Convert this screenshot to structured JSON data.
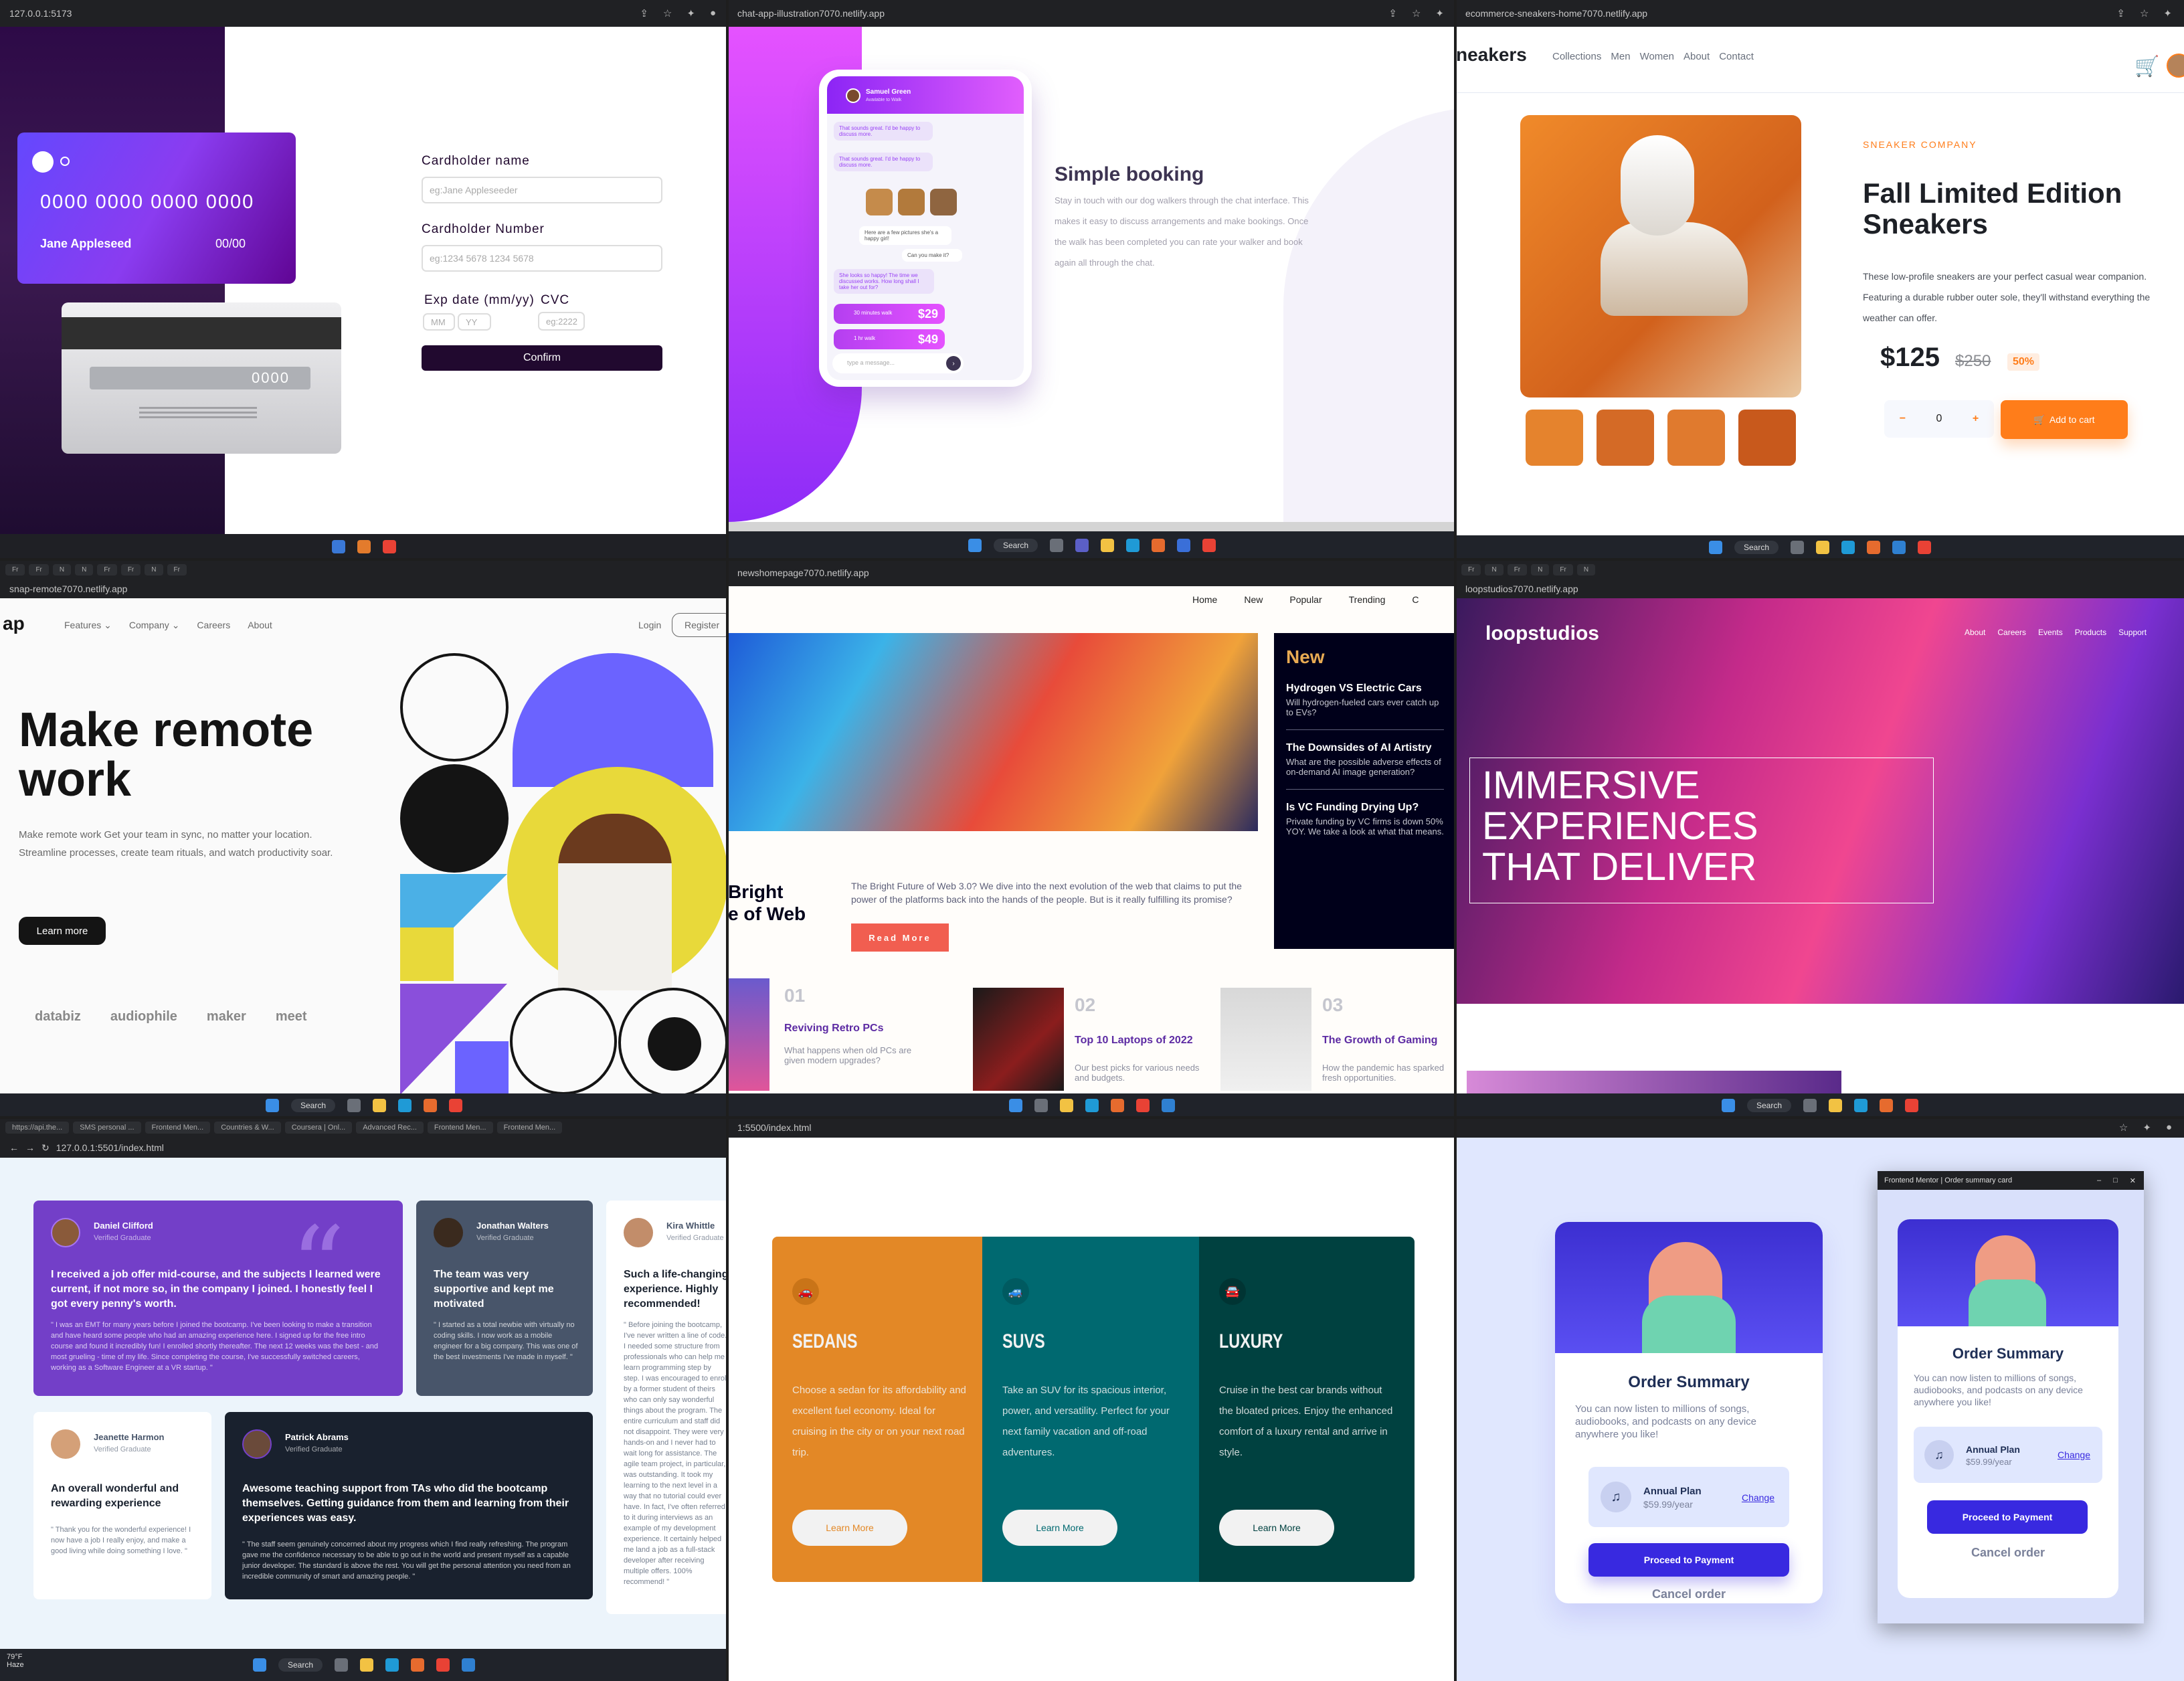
{
  "p1": {
    "url": "127.0.0.1:5173",
    "card_number": "0000 0000 0000 0000",
    "card_name": "Jane Appleseed",
    "card_exp": "00/00",
    "card_cvc": "0000",
    "label_name": "Cardholder name",
    "ph_name": "eg:Jane Appleseeder",
    "label_number": "Cardholder Number",
    "ph_number": "eg:1234 5678 1234 5678",
    "label_exp": "Exp date (mm/yy)",
    "label_cvc": "CVC",
    "ph_mm": "MM",
    "ph_yy": "YY",
    "ph_cvc": "eg:2222",
    "confirm": "Confirm"
  },
  "p2": {
    "url": "chat-app-illustration7070.netlify.app",
    "contact_name": "Samuel Green",
    "contact_status": "Available to Walk",
    "msg1": "That sounds great. I'd be happy to discuss more.",
    "msg2": "That sounds great. I'd be happy to discuss more.",
    "msg3": "Here are a few pictures she's a happy girl!",
    "msg4": "Can you make it?",
    "msg5": "She looks so happy! The time we discussed works. How long shall I take her out for?",
    "offer1_label": "30 minutes walk",
    "offer1_price": "$29",
    "offer2_label": "1 hr walk",
    "offer2_price": "$49",
    "input_ph": "type a message...",
    "heading": "Simple booking",
    "body": "Stay in touch with our dog walkers through the chat interface. This makes it easy to discuss arrangements and make bookings. Once the walk has been completed you can rate your walker and book again all through the chat.",
    "taskbar_search": "Search"
  },
  "p3": {
    "url": "ecommerce-sneakers-home7070.netlify.app",
    "logo": "neakers",
    "nav": [
      "Collections",
      "Men",
      "Women",
      "About",
      "Contact"
    ],
    "company": "SNEAKER COMPANY",
    "title": "Fall Limited Edition Sneakers",
    "desc": "These low-profile sneakers are your perfect casual wear companion. Featuring a durable rubber outer sole, they'll withstand everything the weather can offer.",
    "price": "$125",
    "old_price": "$250",
    "discount": "50%",
    "qty": "0",
    "minus": "−",
    "plus": "+",
    "add_to_cart": "Add to cart",
    "taskbar_search": "Search"
  },
  "p4": {
    "url": "snap-remote7070.netlify.app",
    "logo": "ap",
    "nav": [
      "Features",
      "Company",
      "Careers",
      "About"
    ],
    "login": "Login",
    "register": "Register",
    "headline": "Make remote work",
    "body": "Make remote work Get your team in sync, no matter your location. Streamline processes, create team rituals, and watch productivity soar.",
    "cta": "Learn more",
    "clients": [
      "databiz",
      "audiophile",
      "maker",
      "meet"
    ],
    "taskbar_search": "Search"
  },
  "p5": {
    "url": "newshomepage7070.netlify.app",
    "nav": [
      "Home",
      "New",
      "Popular",
      "Trending",
      "C"
    ],
    "hero_title": "Bright\ne of Web",
    "hero_body": "The Bright Future of Web 3.0? We dive into the next evolution of the web that claims to put the power of the platforms back into the hands of the people. But is it really fulfilling its promise?",
    "read_more": "Read More",
    "new_heading": "New",
    "new_items": [
      {
        "title": "Hydrogen VS Electric Cars",
        "body": "Will hydrogen-fueled cars ever catch up to EVs?"
      },
      {
        "title": "The Downsides of AI Artistry",
        "body": "What are the possible adverse effects of on-demand AI image generation?"
      },
      {
        "title": "Is VC Funding Drying Up?",
        "body": "Private funding by VC firms is down 50% YOY. We take a look at what that means."
      }
    ],
    "bottom": [
      {
        "num": "01",
        "title": "Reviving Retro PCs",
        "body": "What happens when old PCs are given modern upgrades?"
      },
      {
        "num": "02",
        "title": "Top 10 Laptops of 2022",
        "body": "Our best picks for various needs and budgets."
      },
      {
        "num": "03",
        "title": "The Growth of Gaming",
        "body": "How the pandemic has sparked fresh opportunities."
      }
    ]
  },
  "p6": {
    "url": "loopstudios7070.netlify.app",
    "logo": "loopstudios",
    "nav": [
      "About",
      "Careers",
      "Events",
      "Products",
      "Support"
    ],
    "headline": "IMMERSIVE EXPERIENCES THAT DELIVER",
    "taskbar_search": "Search"
  },
  "p7": {
    "url": "127.0.0.1:5501/index.html",
    "tabs": [
      "https://api.the...",
      "SMS personal ...",
      "Frontend Men...",
      "Countries & W...",
      "Coursera | Onl...",
      "Advanced Rec...",
      "Frontend Men...",
      "Frontend Men..."
    ],
    "cards": [
      {
        "name": "Daniel Clifford",
        "role": "Verified Graduate",
        "quote": "I received a job offer mid-course, and the subjects I learned were current, if not more so, in the company I joined. I honestly feel I got every penny's worth.",
        "body": "\" I was an EMT for many years before I joined the bootcamp. I've been looking to make a transition and have heard some people who had an amazing experience here. I signed up for the free intro course and found it incredibly fun! I enrolled shortly thereafter. The next 12 weeks was the best - and most grueling - time of my life. Since completing the course, I've successfully switched careers, working as a Software Engineer at a VR startup. \""
      },
      {
        "name": "Jonathan Walters",
        "role": "Verified Graduate",
        "quote": "The team was very supportive and kept me motivated",
        "body": "\" I started as a total newbie with virtually no coding skills. I now work as a mobile engineer for a big company. This was one of the best investments I've made in myself. \""
      },
      {
        "name": "Kira Whittle",
        "role": "Verified Graduate",
        "quote": "Such a life-changing experience. Highly recommended!",
        "body": "\" Before joining the bootcamp, I've never written a line of code. I needed some structure from professionals who can help me learn programming step by step. I was encouraged to enroll by a former student of theirs who can only say wonderful things about the program. The entire curriculum and staff did not disappoint. They were very hands-on and I never had to wait long for assistance. The agile team project, in particular, was outstanding. It took my learning to the next level in a way that no tutorial could ever have. In fact, I've often referred to it during interviews as an example of my development experience. It certainly helped me land a job as a full-stack developer after receiving multiple offers. 100% recommend! \""
      },
      {
        "name": "Jeanette Harmon",
        "role": "Verified Graduate",
        "quote": "An overall wonderful and rewarding experience",
        "body": "\" Thank you for the wonderful experience! I now have a job I really enjoy, and make a good living while doing something I love. \""
      },
      {
        "name": "Patrick Abrams",
        "role": "Verified Graduate",
        "quote": "Awesome teaching support from TAs who did the bootcamp themselves. Getting guidance from them and learning from their experiences was easy.",
        "body": "\" The staff seem genuinely concerned about my progress which I find really refreshing. The program gave me the confidence necessary to be able to go out in the world and present myself as a capable junior developer. The standard is above the rest. You will get the personal attention you need from an incredible community of smart and amazing people. \""
      }
    ],
    "weather_temp": "79°F",
    "weather_text": "Haze",
    "taskbar_search": "Search"
  },
  "p8": {
    "url": "1:5500/index.html",
    "columns": [
      {
        "title": "SEDANS",
        "body": "Choose a sedan for its affordability and excellent fuel economy. Ideal for cruising in the city or on your next road trip.",
        "btn": "Learn More"
      },
      {
        "title": "SUVS",
        "body": "Take an SUV for its spacious interior, power, and versatility. Perfect for your next family vacation and off-road adventures.",
        "btn": "Learn More"
      },
      {
        "title": "LUXURY",
        "body": "Cruise in the best car brands without the bloated prices. Enjoy the enhanced comfort of a luxury rental and arrive in style.",
        "btn": "Learn More"
      }
    ]
  },
  "p9": {
    "window_title": "Frontend Mentor | Order summary card",
    "card": {
      "title": "Order Summary",
      "body": "You can now listen to millions of songs, audiobooks, and podcasts on any device anywhere you like!",
      "plan": "Annual Plan",
      "plan_price": "$59.99/year",
      "change": "Change",
      "proceed": "Proceed to Payment",
      "cancel": "Cancel order"
    }
  }
}
